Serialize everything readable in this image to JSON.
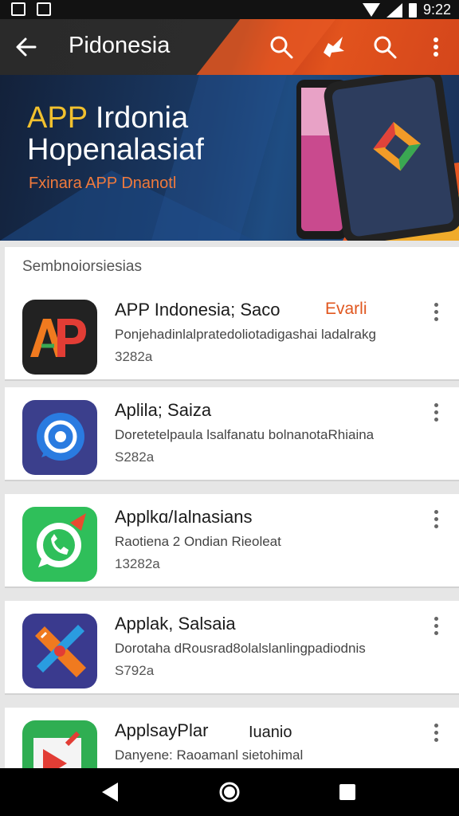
{
  "status_bar": {
    "time": "9:22"
  },
  "app_bar": {
    "title": "Pidonesia"
  },
  "banner": {
    "headline_accent": "APP",
    "headline_rest": " Irdonia",
    "headline_line2": "Hopenalasiaf",
    "subtitle": "Fxinara APP Dnanotl"
  },
  "section": {
    "title": "Sembnoiorsiesias"
  },
  "apps": [
    {
      "name": "APP Indonesia; Saco",
      "badge": "Evarli",
      "description": "Ponjehadinlalpratedoliotadigashai ladalrakg",
      "price": "3282a"
    },
    {
      "name": "Aplila; Saiza",
      "badge": "",
      "description": "Doretetelpaula lsalfanatu bolnanotaRhiaina",
      "price": "S282a"
    },
    {
      "name": "Applkɑ/Ialnasians",
      "badge": "",
      "description": "Raotiena 2 Ondian Rieoleat",
      "price": "13282a"
    },
    {
      "name": "Applak, Salsaia",
      "badge": "",
      "description": "Dorotaha dRousrad8olalslanlingpadiodnis",
      "price": "S792a"
    },
    {
      "name": "ApplsayPlar",
      "badge": "Iuanio",
      "description": "Danyene: Raoamanl sietohimal",
      "price": ""
    }
  ],
  "icons": {
    "back": "arrow-back-icon",
    "search": "search-icon",
    "rocket": "rocket-icon",
    "search2": "search-icon",
    "overflow": "more-vert-icon",
    "nav_back": "triangle-back-icon",
    "nav_home": "circle-home-icon",
    "nav_recent": "square-recent-icon"
  },
  "colors": {
    "accent": "#e0571f",
    "appbar": "#2c2c2c"
  }
}
